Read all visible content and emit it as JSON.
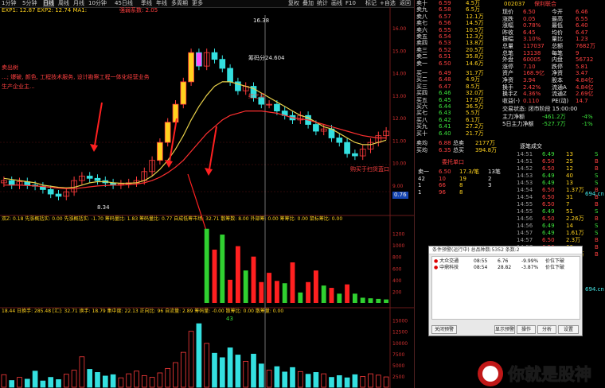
{
  "toolbar": {
    "items": [
      "1分钟",
      "5分钟",
      "日线",
      "周线",
      "月线",
      "10分钟",
      "45日线",
      "季线",
      "年线",
      "多周期",
      "更多"
    ],
    "selected": "日线",
    "right_items": [
      "复权",
      "叠加",
      "统计",
      "画线",
      "F10",
      "标记",
      "+自选",
      "返回"
    ]
  },
  "indicators": {
    "main_line": "EXP1: 12.87  EXP2: 12.74  MA1:",
    "main_tag": "强弱系数: 2.05",
    "notes": [
      "卖出树",
      "...; 爆破, 颜色, 工程技术服务, 设计勘察工程一体化经营业务",
      "生产企业主..."
    ],
    "price_high": "16.38",
    "annot1": "筹码分24.604",
    "annot2": "红三兵",
    "price_low": "8.34",
    "bottom_label": "购买于扫货蓝口",
    "sub1_line": "双Z: 0.18   先涨概括实: 0.00   先涨概括实: -1.70   筹码量比: 1.83   筹码量比: 0.77   自成低筹市场: 32.71   散筹数: 8.00   外部筹: 0.00   筹筹比: 0.00   鼠标筹比: 0.00",
    "sub2_line": "18.44   日换手: 285.48   [汇]: 32.71   换手: 18.79   集中度: 22.13   正向比: 96   自流量: 2.89   筹码量: -0.00   散筹比: 0.00   散筹量: 0.00",
    "small_price": "0.76",
    "top_num": "43"
  },
  "axis_right_main": [
    "16.00",
    "15.00",
    "14.00",
    "13.00",
    "12.00",
    "11.00",
    "10.00",
    "9.00"
  ],
  "axis_right_sub1": [
    "1200",
    "1000",
    "800",
    "600",
    "400",
    "200"
  ],
  "axis_right_sub2": [
    "15000",
    "12500",
    "10000",
    "7500",
    "5000",
    "2500"
  ],
  "quote": {
    "stock_code": "002037",
    "stock_name": "保利联合",
    "asks": [
      {
        "label": "卖十",
        "price": "6.59",
        "vol": "4.5万"
      },
      {
        "label": "卖九",
        "price": "6.58",
        "vol": "6.5万"
      },
      {
        "label": "卖八",
        "price": "6.57",
        "vol": "12.1万"
      },
      {
        "label": "卖七",
        "price": "6.56",
        "vol": "14.5万"
      },
      {
        "label": "卖六",
        "price": "6.55",
        "vol": "10.5万"
      },
      {
        "label": "卖五",
        "price": "6.54",
        "vol": "12.3万"
      },
      {
        "label": "卖四",
        "price": "6.53",
        "vol": "13.8万"
      },
      {
        "label": "卖三",
        "price": "6.52",
        "vol": "20.5万"
      },
      {
        "label": "卖二",
        "price": "6.51",
        "vol": "35.8万"
      },
      {
        "label": "卖一",
        "price": "6.50",
        "vol": "14.6万"
      }
    ],
    "bids": [
      {
        "label": "买一",
        "price": "6.49",
        "vol": "31.7万"
      },
      {
        "label": "买二",
        "price": "6.48",
        "vol": "4.9万"
      },
      {
        "label": "买三",
        "price": "6.47",
        "vol": "8.5万"
      },
      {
        "label": "买四",
        "price": "6.46",
        "vol": "32.0万"
      },
      {
        "label": "买五",
        "price": "6.45",
        "vol": "17.9万"
      },
      {
        "label": "买六",
        "price": "6.44",
        "vol": "36.5万"
      },
      {
        "label": "买七",
        "price": "6.43",
        "vol": "5.5万"
      },
      {
        "label": "买八",
        "price": "6.42",
        "vol": "6.1万"
      },
      {
        "label": "买九",
        "price": "6.41",
        "vol": "27.2万"
      },
      {
        "label": "买十",
        "price": "6.40",
        "vol": "21.7万"
      }
    ],
    "weighted": [
      {
        "label": "卖均",
        "price": "6.88",
        "tag": "总卖",
        "vol": "2177万"
      },
      {
        "label": "买均",
        "price": "6.35",
        "tag": "总买",
        "vol": "394.8万"
      }
    ],
    "stats": [
      {
        "k": "现价",
        "v": "6.50",
        "k2": "今开",
        "v2": "6.46"
      },
      {
        "k": "涨跌",
        "v": "0.05",
        "k2": "最高",
        "v2": "6.55"
      },
      {
        "k": "涨幅",
        "v": "0.78%",
        "k2": "最低",
        "v2": "6.40"
      },
      {
        "k": "昨收",
        "v": "6.45",
        "k2": "均价",
        "v2": "6.47"
      },
      {
        "k": "振幅",
        "v": "3.10%",
        "k2": "量比",
        "v2": "1.23"
      },
      {
        "k": "总量",
        "v": "117037",
        "k2": "总额",
        "v2": "7682万"
      },
      {
        "k": "总笔",
        "v": "13138",
        "k2": "每笔",
        "v2": "9"
      },
      {
        "k": "外盘",
        "v": "60005",
        "k2": "内盘",
        "v2": "56732"
      },
      {
        "k": "涨停",
        "v": "7.10",
        "k2": "跌停",
        "v2": "5.81"
      },
      {
        "k": "资产",
        "v": "168.9亿",
        "k2": "净资",
        "v2": "3.47"
      },
      {
        "k": "净资",
        "v": "3.94",
        "k2": "股本",
        "v2": "4.84亿"
      },
      {
        "k": "换手",
        "v": "2.42%",
        "k2": "流通A",
        "v2": "4.84亿"
      },
      {
        "k": "换手Z",
        "v": "4.36%",
        "k2": "流通Z",
        "v2": "2.69亿"
      },
      {
        "k": "收益(-)",
        "v": "0.110",
        "k2": "PE(动)",
        "v2": "14.7"
      }
    ],
    "status": "交易状态: 闭市阶段   15:00:00",
    "netflow": [
      {
        "label": "主力净额",
        "v": "-461.2万",
        "p": "-4%"
      },
      {
        "label": "5日主力净额",
        "v": "-527.7万",
        "p": "-1%"
      }
    ],
    "order_title": "委托单口",
    "order_rows": [
      {
        "side": "卖一",
        "price": "6.50",
        "vol": "17.3/笔",
        "n": "13笔"
      },
      {
        "side": "42",
        "price": "10",
        "vol": "19",
        "n": "2"
      },
      {
        "side": "1",
        "price": "66",
        "vol": "8",
        "n": "3"
      },
      {
        "side": "1",
        "price": "96",
        "vol": "8",
        "n": ""
      }
    ],
    "tick_title": "逐笔成交",
    "ticks": [
      {
        "t": "14:51",
        "p": "6.49",
        "v": "13",
        "f": "S"
      },
      {
        "t": "14:51",
        "p": "6.50",
        "v": "25",
        "f": "B"
      },
      {
        "t": "14:52",
        "p": "6.50",
        "v": "12",
        "f": "B"
      },
      {
        "t": "14:53",
        "p": "6.49",
        "v": "40",
        "f": "S"
      },
      {
        "t": "14:53",
        "p": "6.49",
        "v": "13",
        "f": "S"
      },
      {
        "t": "14:54",
        "p": "6.50",
        "v": "1.37万",
        "f": "B"
      },
      {
        "t": "14:54",
        "p": "6.50",
        "v": "31",
        "f": "B"
      },
      {
        "t": "14:55",
        "p": "6.50",
        "v": "7",
        "f": "B"
      },
      {
        "t": "14:55",
        "p": "6.49",
        "v": "51",
        "f": "S"
      },
      {
        "t": "14:56",
        "p": "6.50",
        "v": "2.26万",
        "f": "B"
      },
      {
        "t": "14:56",
        "p": "6.49",
        "v": "14",
        "f": "S"
      },
      {
        "t": "14:57",
        "p": "6.49",
        "v": "1.61万",
        "f": "S"
      },
      {
        "t": "14:57",
        "p": "6.50",
        "v": "2.3万",
        "f": "B"
      },
      {
        "t": "14:57",
        "p": "6.50",
        "v": "60",
        "f": "B"
      },
      {
        "t": "15:00",
        "p": "6.50",
        "v": "1.13万",
        "f": "B"
      }
    ],
    "right_strip": [
      "694.cn",
      "694.cn"
    ]
  },
  "dialog": {
    "title": "条件预警(运行中) 总品种数:5352 条数:2",
    "rows": [
      {
        "name": "大众交通",
        "time": "08:55",
        "price": "6.76",
        "pct": "-9.99%",
        "type": "价位下破"
      },
      {
        "name": "中鼎科技",
        "time": "08:54",
        "price": "28.82",
        "pct": "-3.87%",
        "type": "价位下破"
      }
    ],
    "buttons": [
      "关闭预警",
      "显示预警",
      "操作",
      "分析",
      "设置"
    ]
  },
  "watermark": "你就是股神",
  "colors": {
    "up": "#ff3c3c",
    "down": "#34e0e0",
    "ma_yellow": "#e8d04a",
    "ma_red": "#ff3030",
    "vol_green": "#30d030"
  },
  "chart_data": {
    "type": "candlestick",
    "x": [
      "D1",
      "D2",
      "D3",
      "D4",
      "D5",
      "D6",
      "D7",
      "D8",
      "D9",
      "D10",
      "D11",
      "D12",
      "D13",
      "D14",
      "D15",
      "D16",
      "D17",
      "D18",
      "D19",
      "D20",
      "D21",
      "D22",
      "D23",
      "D24",
      "D25",
      "D26",
      "D27",
      "D28",
      "D29",
      "D30",
      "D31",
      "D32",
      "D33",
      "D34",
      "D35",
      "D36",
      "D37",
      "D38",
      "D39",
      "D40",
      "D41",
      "D42",
      "D43",
      "D44",
      "D45",
      "D46",
      "D47",
      "D48",
      "D49",
      "D50"
    ],
    "open": [
      9.1,
      9.2,
      9.0,
      9.15,
      9.0,
      8.95,
      8.8,
      8.6,
      8.5,
      8.7,
      9.2,
      9.4,
      9.3,
      9.2,
      9.1,
      9.0,
      9.05,
      9.1,
      9.2,
      9.6,
      10.1,
      10.9,
      11.8,
      12.6,
      13.6,
      14.9,
      14.3,
      14.9,
      14.6,
      14.2,
      13.6,
      13.2,
      13.4,
      12.9,
      12.6,
      12.6,
      12.3,
      12.1,
      11.9,
      12.1,
      11.7,
      11.4,
      11.5,
      11.1,
      10.9,
      10.4,
      10.3,
      10.6,
      10.9,
      11.2
    ],
    "close": [
      9.2,
      9.0,
      9.15,
      9.0,
      8.95,
      8.8,
      8.6,
      8.5,
      8.7,
      9.2,
      9.4,
      9.3,
      9.2,
      9.1,
      9.0,
      9.05,
      9.1,
      9.2,
      9.6,
      10.1,
      10.9,
      11.8,
      12.6,
      13.6,
      14.9,
      14.3,
      14.9,
      14.6,
      14.2,
      13.6,
      13.2,
      13.4,
      12.9,
      12.6,
      12.6,
      12.3,
      12.1,
      11.9,
      12.1,
      11.7,
      11.4,
      11.5,
      11.1,
      10.9,
      10.4,
      10.3,
      10.6,
      10.9,
      11.2,
      11.4
    ],
    "ma_yellow": [
      9.3,
      9.25,
      9.2,
      9.15,
      9.1,
      9.0,
      8.95,
      8.9,
      8.88,
      8.9,
      9.0,
      9.1,
      9.15,
      9.15,
      9.1,
      9.08,
      9.08,
      9.1,
      9.2,
      9.4,
      9.7,
      10.1,
      10.6,
      11.2,
      11.9,
      12.5,
      13.0,
      13.4,
      13.6,
      13.6,
      13.5,
      13.4,
      13.3,
      13.1,
      12.9,
      12.7,
      12.5,
      12.3,
      12.1,
      12.0,
      11.8,
      11.6,
      11.5,
      11.3,
      11.1,
      10.9,
      10.8,
      10.8,
      10.9,
      11.0
    ],
    "ma_red": [
      9.0,
      9.0,
      9.0,
      8.98,
      8.96,
      8.94,
      8.9,
      8.86,
      8.84,
      8.84,
      8.88,
      8.92,
      8.96,
      8.98,
      9.0,
      9.0,
      9.02,
      9.05,
      9.1,
      9.2,
      9.35,
      9.55,
      9.8,
      10.1,
      10.5,
      10.9,
      11.3,
      11.6,
      11.9,
      12.1,
      12.2,
      12.3,
      12.3,
      12.3,
      12.25,
      12.2,
      12.1,
      12.0,
      11.95,
      11.9,
      11.8,
      11.7,
      11.6,
      11.5,
      11.4,
      11.3,
      11.2,
      11.15,
      11.1,
      11.1
    ],
    "ylim": [
      8.0,
      16.5
    ],
    "sub1_values": [
      0,
      0,
      0,
      0,
      0,
      0,
      0,
      0,
      0,
      0,
      0,
      0,
      0,
      0,
      0,
      0,
      0,
      0,
      0,
      0,
      0,
      0,
      0,
      0,
      0,
      0,
      1280,
      920,
      1180,
      400,
      980,
      560,
      800,
      360,
      520,
      380,
      340,
      700,
      180,
      360,
      560,
      300,
      260,
      160,
      320,
      160,
      90,
      80,
      70,
      60
    ],
    "sub1_colors": [
      "g",
      "g",
      "g",
      "g",
      "g",
      "g",
      "g",
      "g",
      "g",
      "g",
      "g",
      "g",
      "g",
      "g",
      "g",
      "g",
      "g",
      "g",
      "g",
      "g",
      "g",
      "g",
      "g",
      "g",
      "g",
      "g",
      "g",
      "r",
      "g",
      "r",
      "r",
      "g",
      "r",
      "r",
      "r",
      "r",
      "g",
      "r",
      "g",
      "r",
      "r",
      "g",
      "r",
      "g",
      "r",
      "g",
      "g",
      "g",
      "g",
      "g"
    ],
    "sub1_ylim": [
      0,
      1400
    ],
    "sub2_values": [
      2800,
      1500,
      2200,
      1800,
      3600,
      1400,
      2200,
      1700,
      2900,
      3800,
      6800,
      4000,
      3300,
      2500,
      2800,
      2100,
      3000,
      3600,
      2600,
      2200,
      3200,
      4200,
      5500,
      7800,
      12500,
      14200,
      9800,
      7600,
      6600,
      8800,
      7200,
      5800,
      7400,
      5200,
      3800,
      4600,
      3400,
      4400,
      3500,
      2900,
      3300,
      3000,
      2200,
      2600,
      2100,
      2800,
      2400,
      3000,
      2700,
      2300
    ],
    "sub2_ylim": [
      0,
      16000
    ]
  }
}
